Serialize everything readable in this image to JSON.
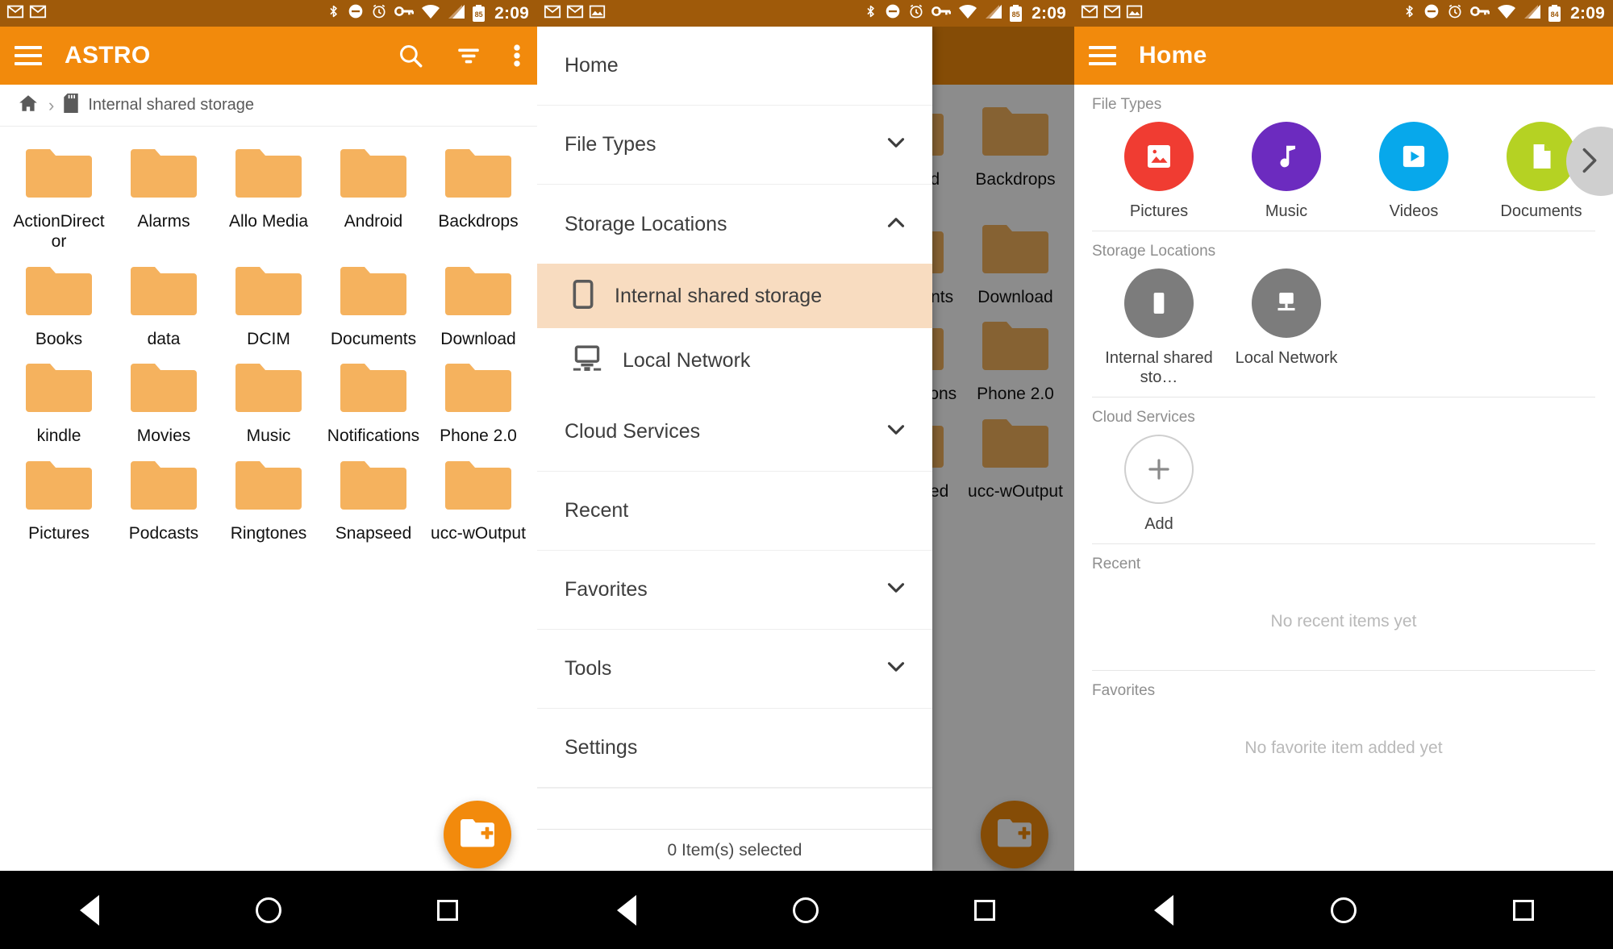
{
  "status_bar": {
    "icons": [
      "gmail-icon",
      "gmail-icon",
      "photo-icon",
      "bluetooth-icon",
      "do-not-disturb-icon",
      "alarm-icon",
      "vpn-key-icon",
      "wifi-icon",
      "signal-icon"
    ],
    "battery_p1": "85",
    "battery_p3": "84",
    "time": "2:09"
  },
  "panel1": {
    "appbar": {
      "title": "ASTRO",
      "menu_icon": "hamburger-menu-icon",
      "actions": [
        "search-icon",
        "filter-icon",
        "overflow-menu-icon"
      ]
    },
    "breadcrumb": {
      "home_icon": "home-icon",
      "separator": "›",
      "storage_icon": "sd-card-icon",
      "path": "Internal shared storage"
    },
    "folders": [
      "ActionDirector",
      "Alarms",
      "Allo Media",
      "Android",
      "Backdrops",
      "Books",
      "data",
      "DCIM",
      "Documents",
      "Download",
      "kindle",
      "Movies",
      "Music",
      "Notifications",
      "Phone 2.0",
      "Pictures",
      "Podcasts",
      "Ringtones",
      "Snapseed",
      "ucc-wOutput"
    ],
    "fab": {
      "icon": "create-new-folder-icon",
      "label": "Create new folder"
    }
  },
  "panel2": {
    "drawer": {
      "items": [
        {
          "label": "Home",
          "expander": "none",
          "selected": false
        },
        {
          "label": "File Types",
          "expander": "chevron-down-icon",
          "selected": false
        },
        {
          "label": "Storage Locations",
          "expander": "chevron-up-icon",
          "selected": false
        }
      ],
      "storage_children": [
        {
          "label": "Internal shared storage",
          "icon": "phone-icon",
          "selected": true
        },
        {
          "label": "Local Network",
          "icon": "desktop-network-icon",
          "selected": false
        }
      ],
      "items_after": [
        {
          "label": "Cloud Services",
          "expander": "chevron-down-icon"
        },
        {
          "label": "Recent",
          "expander": "none"
        },
        {
          "label": "Favorites",
          "expander": "chevron-down-icon"
        },
        {
          "label": "Tools",
          "expander": "chevron-down-icon"
        },
        {
          "label": "Settings",
          "expander": "none"
        }
      ],
      "footer": "0 Item(s) selected"
    },
    "background_folders": [
      "Android",
      "Backdrops",
      "Documents",
      "Download",
      "Notifications",
      "Phone 2.0",
      "Snapseed",
      "ucc-wOutput"
    ]
  },
  "panel3": {
    "appbar": {
      "title": "Home",
      "menu_icon": "hamburger-menu-icon"
    },
    "sections": {
      "file_types": {
        "label": "File Types",
        "items": [
          {
            "label": "Pictures",
            "icon": "image-icon",
            "color": "#f03c32"
          },
          {
            "label": "Music",
            "icon": "music-note-icon",
            "color": "#6c2bbf"
          },
          {
            "label": "Videos",
            "icon": "video-play-icon",
            "color": "#07a8eb"
          },
          {
            "label": "Documents",
            "icon": "document-icon",
            "color": "#b5d223"
          }
        ],
        "arrow": "chevron-right-icon"
      },
      "storage_locations": {
        "label": "Storage Locations",
        "items": [
          {
            "label": "Internal shared sto…",
            "icon": "phone-icon",
            "color": "#7c7c7c"
          },
          {
            "label": "Local Network",
            "icon": "desktop-network-icon",
            "color": "#7c7c7c"
          }
        ]
      },
      "cloud_services": {
        "label": "Cloud Services",
        "add_label": "Add",
        "add_icon": "plus-icon"
      },
      "recent": {
        "label": "Recent",
        "empty": "No recent items yet"
      },
      "favorites": {
        "label": "Favorites",
        "empty": "No favorite item added yet"
      }
    }
  },
  "nav_bar": {
    "back": "back-triangle-icon",
    "home": "home-circle-icon",
    "recents": "recents-square-icon"
  },
  "colors": {
    "accent": "#f28a0c",
    "status_bar": "#9f5a0a",
    "folder": "#f5b25e",
    "selected_row": "#f8dcc0"
  }
}
